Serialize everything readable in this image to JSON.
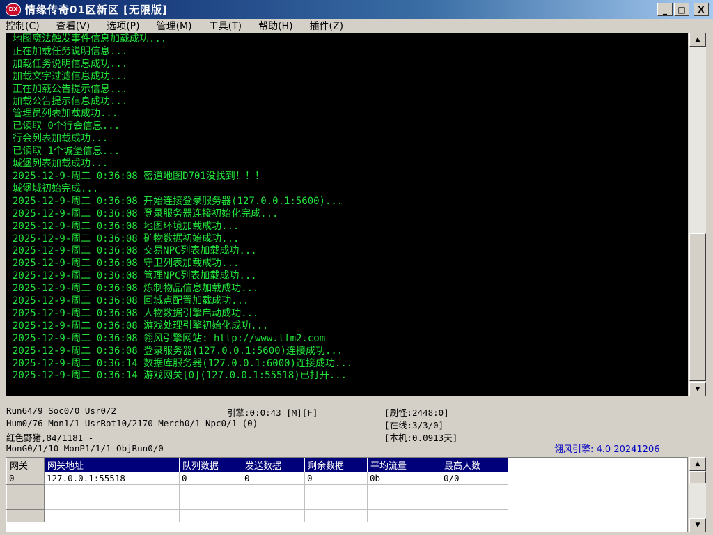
{
  "window": {
    "icon_text": "DX",
    "title": "情缘传奇01区新区 [无限版]",
    "buttons": {
      "minimize": "_",
      "maximize": "□",
      "close": "X"
    }
  },
  "menu": [
    {
      "label": "控制(C)"
    },
    {
      "label": "查看(V)"
    },
    {
      "label": "选项(P)"
    },
    {
      "label": "管理(M)"
    },
    {
      "label": "工具(T)"
    },
    {
      "label": "帮助(H)"
    },
    {
      "label": "插件(Z)"
    }
  ],
  "console": {
    "lines": [
      "地图魔法触发事件信息加载成功...",
      "正在加载任务说明信息...",
      "加载任务说明信息成功...",
      "加载文字过滤信息成功...",
      "正在加载公告提示信息...",
      "加载公告提示信息成功...",
      "管理员列表加载成功...",
      "已读取 0个行会信息...",
      "行会列表加载成功...",
      "已读取 1个城堡信息...",
      "城堡列表加载成功...",
      "2025-12-9-周二 0:36:08 密道地图D701没找到！！！",
      "城堡城初始完成...",
      "2025-12-9-周二 0:36:08 开始连接登录服务器(127.0.0.1:5600)...",
      "2025-12-9-周二 0:36:08 登录服务器连接初始化完成...",
      "2025-12-9-周二 0:36:08 地图环境加载成功...",
      "2025-12-9-周二 0:36:08 矿物数据初始成功...",
      "2025-12-9-周二 0:36:08 交易NPC列表加载成功...",
      "2025-12-9-周二 0:36:08 守卫列表加载成功...",
      "2025-12-9-周二 0:36:08 管理NPC列表加载成功...",
      "2025-12-9-周二 0:36:08 炼制物品信息加载成功...",
      "2025-12-9-周二 0:36:08 回城点配置加载成功...",
      "2025-12-9-周二 0:36:08 人物数据引擎启动成功...",
      "2025-12-9-周二 0:36:08 游戏处理引擎初始化成功...",
      "2025-12-9-周二 0:36:08 翎风引擎网站: http://www.lfm2.com",
      "2025-12-9-周二 0:36:08 登录服务器(127.0.0.1:5600)连接成功...",
      "2025-12-9-周二 0:36:14 数据库服务器(127.0.0.1:6000)连接成功...",
      "2025-12-9-周二 0:36:14 游戏网关[0](127.0.0.1:55518)已打开..."
    ]
  },
  "status": {
    "run": "Run64/9 Soc0/0 Usr0/2",
    "engine_time": "引擎:0:0:43 [M][F]",
    "refresh": "[刷怪:2448:0]",
    "hum": "Hum0/76 Mon1/1 UsrRot10/2170 Merch0/1 Npc0/1 (0)",
    "online": "[在线:3/3/0]",
    "monster": "红色野猪,84/1181 -",
    "local": "[本机:0.0913天]",
    "mongen": "MonG0/1/10 MonP1/1/1 ObjRun0/0",
    "version": "翎风引擎: 4.0 20241206"
  },
  "gateway_table": {
    "headers": [
      "网关",
      "网关地址",
      "队列数据",
      "发送数据",
      "剩余数据",
      "平均流量",
      "最高人数"
    ],
    "rows": [
      [
        "0",
        "127.0.0.1:55518",
        "0",
        "0",
        "0",
        "0b",
        "0/0"
      ]
    ]
  },
  "icons": {
    "arrow_up": "▲",
    "arrow_down": "▼"
  }
}
